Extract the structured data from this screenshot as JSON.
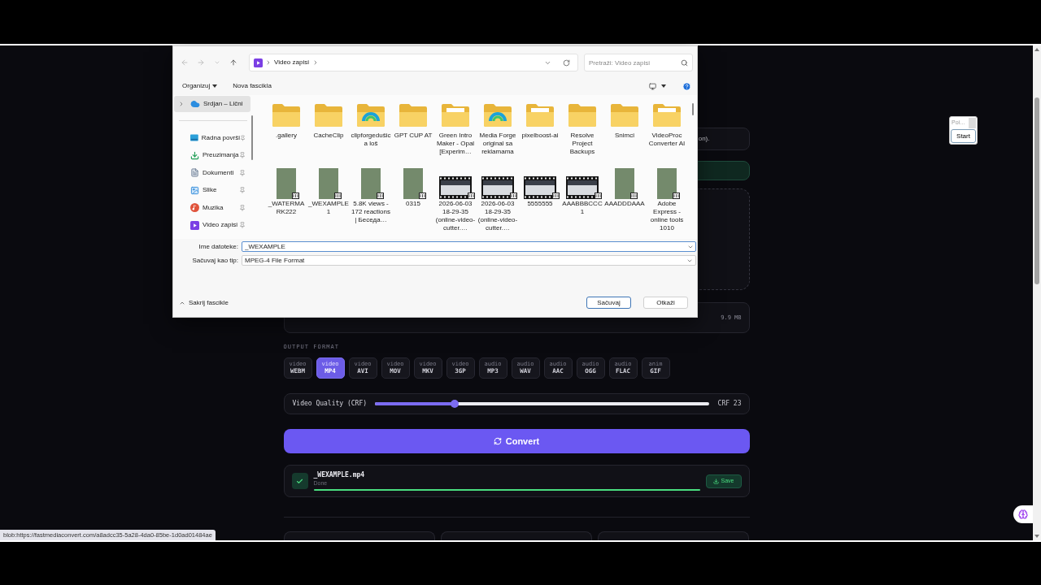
{
  "screen": {
    "status_url": "blob:https://fastmediaconvert.com/a8adcc35-5a28-4da0-85be-1d0ad01484ae"
  },
  "widget": {
    "placeholder": "Poi…",
    "button": "Start"
  },
  "page": {
    "info_text": "on).",
    "source_file": {
      "size": "9.9 MB"
    },
    "output_format": {
      "label": "OUTPUT FORMAT",
      "options": [
        {
          "category": "video",
          "format": "WEBM",
          "selected": false
        },
        {
          "category": "video",
          "format": "MP4",
          "selected": true
        },
        {
          "category": "video",
          "format": "AVI",
          "selected": false
        },
        {
          "category": "video",
          "format": "MOV",
          "selected": false
        },
        {
          "category": "video",
          "format": "MKV",
          "selected": false
        },
        {
          "category": "video",
          "format": "3GP",
          "selected": false
        },
        {
          "category": "audio",
          "format": "MP3",
          "selected": false
        },
        {
          "category": "audio",
          "format": "WAV",
          "selected": false
        },
        {
          "category": "audio",
          "format": "AAC",
          "selected": false
        },
        {
          "category": "audio",
          "format": "OGG",
          "selected": false
        },
        {
          "category": "audio",
          "format": "FLAC",
          "selected": false
        },
        {
          "category": "anim",
          "format": "GIF",
          "selected": false
        }
      ]
    },
    "quality": {
      "label": "Video Quality (CRF)",
      "level": 0.24,
      "reading": "CRF 23"
    },
    "convert_button": "Convert",
    "result": {
      "filename": "_WEXAMPLE.mp4",
      "status": "Done",
      "done": true,
      "level": 1,
      "save_button": "Save"
    }
  },
  "dialog": {
    "nav_buttons": [
      {
        "kind": "back",
        "disabled": true
      },
      {
        "kind": "forward",
        "disabled": true
      },
      {
        "kind": "recent",
        "disabled": true
      },
      {
        "kind": "up",
        "disabled": false
      }
    ],
    "address": {
      "crumbs": [
        "Video zapisi"
      ]
    },
    "search": {
      "placeholder": "Pretraži: Video zapisi"
    },
    "toolbar": {
      "organize": "Organizuj",
      "new_folder": "Nova fascikla"
    },
    "nav": {
      "roots": [
        {
          "label": "Srdjan – Lični",
          "kind": "cloud",
          "selected": true,
          "pinned": false,
          "expanded": false
        }
      ],
      "quick_access": [
        {
          "label": "Radna površi",
          "kind": "desktop",
          "selected": false,
          "pinned": true
        },
        {
          "label": "Preuzimanja",
          "kind": "downloads",
          "selected": false,
          "pinned": true
        },
        {
          "label": "Dokumenti",
          "kind": "documents",
          "selected": false,
          "pinned": true
        },
        {
          "label": "Slike",
          "kind": "pictures",
          "selected": false,
          "pinned": true
        },
        {
          "label": "Muzika",
          "kind": "music",
          "selected": false,
          "pinned": true
        },
        {
          "label": "Video zapisi",
          "kind": "videos",
          "selected": false,
          "pinned": true
        }
      ]
    },
    "files": [
      {
        "label": ".gallery",
        "kind": "folder"
      },
      {
        "label": "CacheClip",
        "kind": "folder"
      },
      {
        "label": "clipforgedušica loš",
        "kind": "appfolder"
      },
      {
        "label": "GPT CUP AT",
        "kind": "folder"
      },
      {
        "label": "Green Intro Maker - Opal [Experim…",
        "kind": "docfolder"
      },
      {
        "label": "Media Forge original sa reklamama",
        "kind": "appfolder"
      },
      {
        "label": "pixelboost-ai",
        "kind": "docfolder"
      },
      {
        "label": "Resolve Project Backups",
        "kind": "folder"
      },
      {
        "label": "Snimci",
        "kind": "folder"
      },
      {
        "label": "VideoProc Converter AI",
        "kind": "docfolder"
      },
      {
        "label": "_WATERMARK222",
        "kind": "video"
      },
      {
        "label": "_WEXAMPLE1",
        "kind": "video"
      },
      {
        "label": "5.8K views - 172 reactions | Беседа…",
        "kind": "video"
      },
      {
        "label": "0315",
        "kind": "video"
      },
      {
        "label": "2026-06-03 18-29-35 (online-video-cutter.…",
        "kind": "filmclip"
      },
      {
        "label": "2026-06-03 18-29-35 (online-video-cutter.…",
        "kind": "filmclip"
      },
      {
        "label": "5555555",
        "kind": "filmclip"
      },
      {
        "label": "AAABBBCCC1",
        "kind": "filmclip"
      },
      {
        "label": "AAADDDAAA",
        "kind": "video"
      },
      {
        "label": "Adobe Express - online tools 1010",
        "kind": "video"
      }
    ],
    "fields": [
      {
        "kind": "input",
        "label": "Ime datoteke:",
        "value": "_WEXAMPLE",
        "focused": true
      },
      {
        "kind": "select",
        "label": "Sačuvaj kao tip:",
        "value": "MPEG-4 File Format",
        "focused": false
      }
    ],
    "footer": {
      "toggle": "Sakrij fascikle",
      "buttons": [
        {
          "label": "Sačuvaj",
          "primary": true
        },
        {
          "label": "Otkaži",
          "primary": false
        }
      ]
    }
  }
}
